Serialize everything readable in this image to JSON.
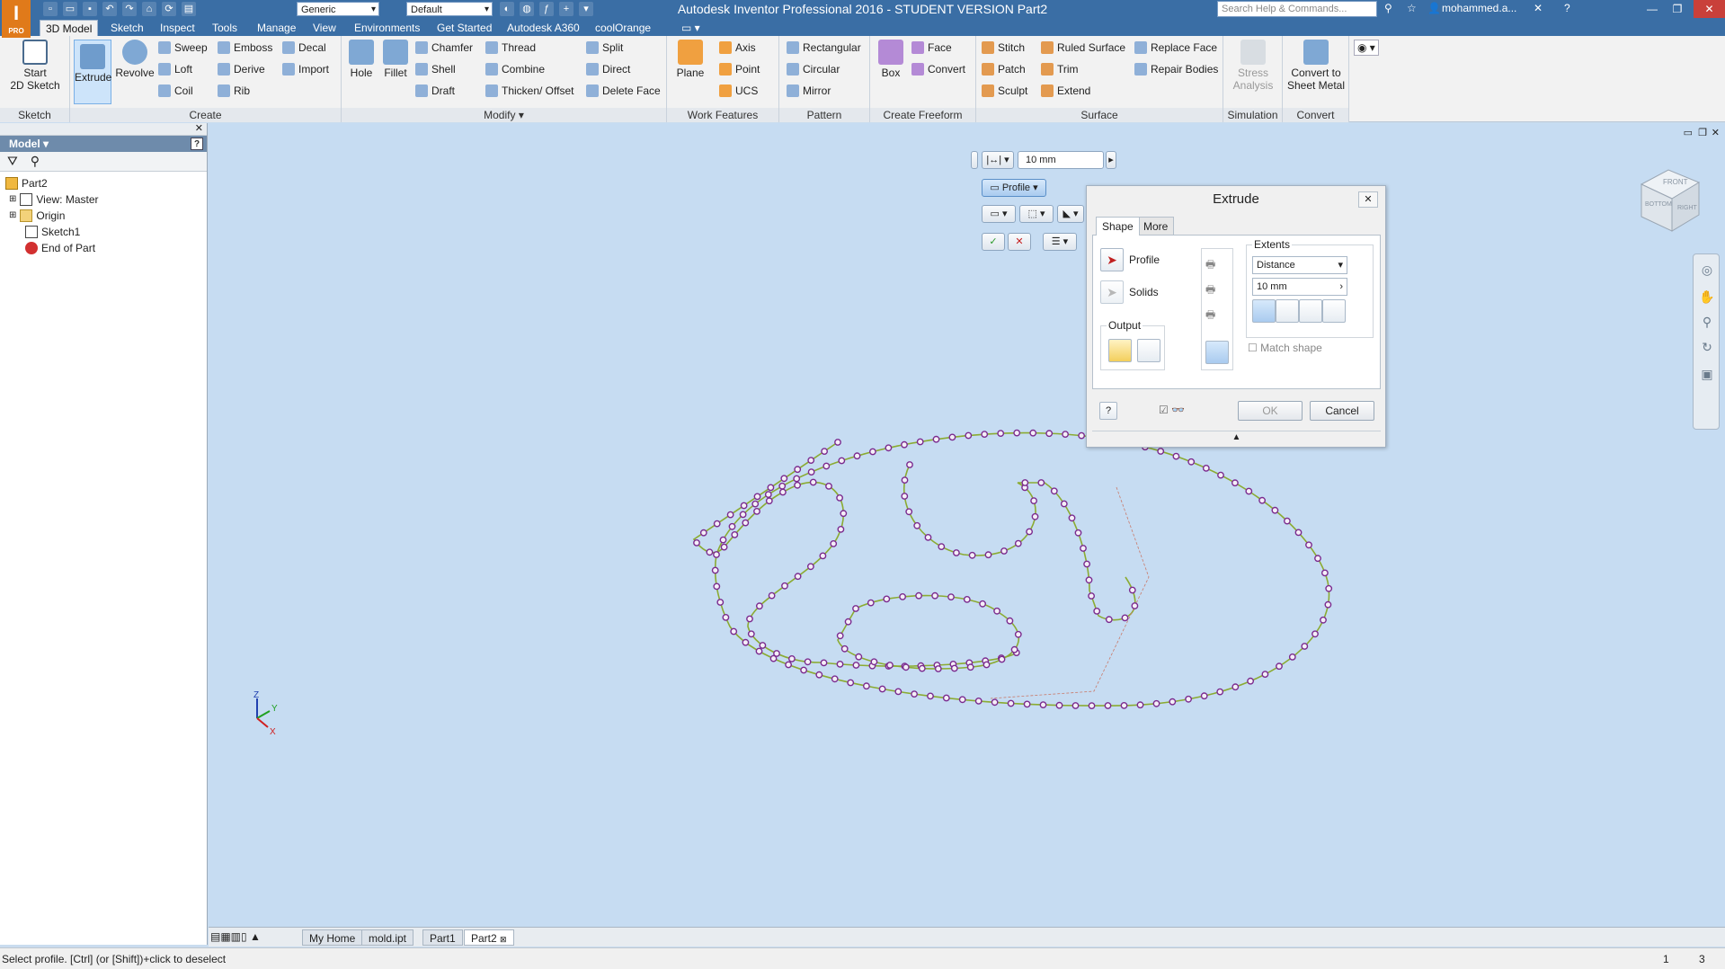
{
  "app": {
    "logo_text": "I",
    "logo_sub": "PRO",
    "title": "Autodesk Inventor Professional 2016 - STUDENT VERSION    Part2",
    "search_placeholder": "Search Help & Commands...",
    "user": "mohammed.a...",
    "material_combo": "Generic",
    "appearance_combo": "Default"
  },
  "ribbon_tabs": [
    {
      "label": "3D Model",
      "active": true
    },
    {
      "label": "Sketch"
    },
    {
      "label": "Inspect"
    },
    {
      "label": "Tools"
    },
    {
      "label": "Manage"
    },
    {
      "label": "View"
    },
    {
      "label": "Environments"
    },
    {
      "label": "Get Started"
    },
    {
      "label": "Autodesk A360"
    },
    {
      "label": "coolOrange"
    }
  ],
  "ribbon": {
    "sketch": {
      "title": "Sketch",
      "start_sketch": "Start\n2D Sketch"
    },
    "create": {
      "title": "Create",
      "extrude": "Extrude",
      "revolve": "Revolve",
      "sweep": "Sweep",
      "loft": "Loft",
      "coil": "Coil",
      "emboss": "Emboss",
      "derive": "Derive",
      "rib": "Rib",
      "decal": "Decal",
      "import": "Import"
    },
    "modify": {
      "title": "Modify ▾",
      "hole": "Hole",
      "fillet": "Fillet",
      "chamfer": "Chamfer",
      "shell": "Shell",
      "draft": "Draft",
      "thread": "Thread",
      "combine": "Combine",
      "thicken": "Thicken/ Offset",
      "split": "Split",
      "direct": "Direct",
      "delete_face": "Delete Face"
    },
    "work_features": {
      "title": "Work Features",
      "plane": "Plane",
      "axis": "Axis",
      "point": "Point",
      "ucs": "UCS"
    },
    "pattern": {
      "title": "Pattern",
      "rectangular": "Rectangular",
      "circular": "Circular",
      "mirror": "Mirror"
    },
    "freeform": {
      "title": "Create Freeform",
      "box": "Box",
      "face": "Face",
      "convert": "Convert"
    },
    "surface": {
      "title": "Surface",
      "stitch": "Stitch",
      "patch": "Patch",
      "sculpt": "Sculpt",
      "ruled": "Ruled Surface",
      "trim": "Trim",
      "extend": "Extend",
      "replace": "Replace Face",
      "repair": "Repair Bodies"
    },
    "simulation": {
      "title": "Simulation",
      "stress": "Stress\nAnalysis"
    },
    "convert": {
      "title": "Convert",
      "sheet_metal": "Convert to\nSheet Metal"
    }
  },
  "browser": {
    "header": "Model ▾",
    "tree": [
      {
        "label": "Part2",
        "icon": "part-icon"
      },
      {
        "label": "View: Master",
        "icon": "view-icon"
      },
      {
        "label": "Origin",
        "icon": "folder-icon"
      },
      {
        "label": "Sketch1",
        "icon": "sketch-icon"
      },
      {
        "label": "End of Part",
        "icon": "end-of-part-icon"
      }
    ]
  },
  "minitoolbar": {
    "distance_value": "10 mm",
    "profile_label": "Profile"
  },
  "extrude_dialog": {
    "title": "Extrude",
    "tabs": [
      {
        "label": "Shape",
        "active": true
      },
      {
        "label": "More"
      }
    ],
    "profile_label": "Profile",
    "solids_label": "Solids",
    "output_label": "Output",
    "extents_label": "Extents",
    "extents_type": "Distance",
    "distance": "10 mm",
    "match_shape": "Match shape",
    "ok": "OK",
    "cancel": "Cancel"
  },
  "doc_tabs": [
    {
      "label": "My Home"
    },
    {
      "label": "mold.ipt"
    },
    {
      "label": "Part1"
    },
    {
      "label": "Part2",
      "active": true
    }
  ],
  "status": {
    "message": "Select profile. [Ctrl] (or [Shift])+click to deselect",
    "count1": "1",
    "count2": "3"
  },
  "viewcube": {
    "front": "FRONT",
    "bottom": "BOTTOM",
    "right": "RIGHT"
  },
  "axes": {
    "x": "X",
    "y": "Y",
    "z": "Z"
  },
  "colors": {
    "accent": "#3a6ea5",
    "sketch_line": "#8bab32",
    "sketch_point": "#7a2a8e",
    "viewport": "#c6dcf2"
  }
}
